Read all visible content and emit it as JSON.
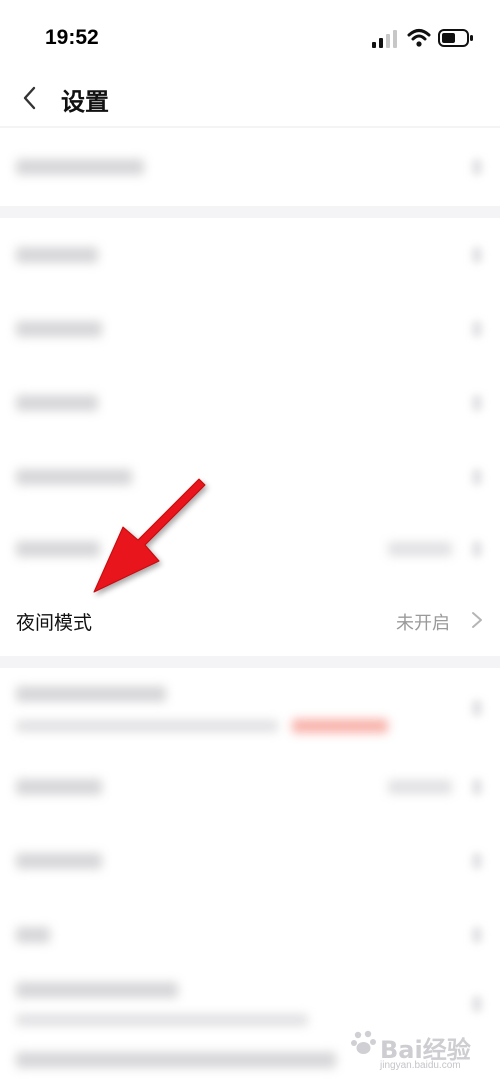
{
  "status_bar": {
    "time": "19:52"
  },
  "header": {
    "title": "设置"
  },
  "night_mode": {
    "label": "夜间模式",
    "value": "未开启"
  },
  "watermark": {
    "brand": "Bai经验",
    "sub": "jingyan.baidu.com"
  },
  "colors": {
    "annotation_arrow": "#e8131b",
    "value_gray": "#9a9a9a",
    "background": "#f4f4f6"
  }
}
